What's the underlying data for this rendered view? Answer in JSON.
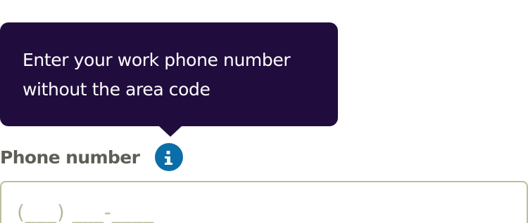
{
  "tooltip": {
    "text": "Enter your work phone number without the area code",
    "background_color": "#200d3d"
  },
  "field": {
    "label": "Phone number",
    "info_icon": "info-icon",
    "info_icon_color": "#0b6ea8",
    "value": "",
    "placeholder": "(___) ___-____"
  }
}
